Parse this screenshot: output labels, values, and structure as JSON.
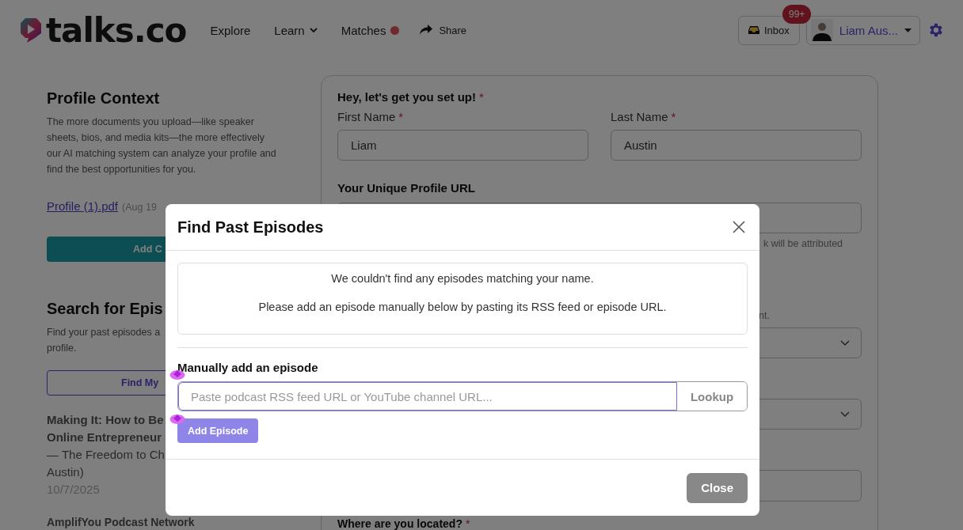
{
  "header": {
    "logo": "talks.co",
    "nav": [
      {
        "label": "Explore",
        "kind": "link"
      },
      {
        "label": "Learn",
        "kind": "dropdown"
      },
      {
        "label": "Matches",
        "kind": "dot"
      },
      {
        "label": "Share",
        "kind": "share"
      }
    ],
    "inbox": {
      "label": "Inbox",
      "badge": "99+"
    },
    "user": {
      "name": "Liam Aus..."
    }
  },
  "profile_context": {
    "title": "Profile Context",
    "description": "The more documents you upload—like speaker sheets, bios, and media kits—the more effectively our AI matching system can analyze your profile and find the best opportunities for you.",
    "file": {
      "name": "Profile (1).pdf",
      "date": "(Aug 19"
    },
    "button": "Add C"
  },
  "search_episodes": {
    "title": "Search for Epis",
    "description_lines": [
      "Find your past episodes a",
      "profile."
    ],
    "button": "Find My"
  },
  "episodes": [
    {
      "title_lines": [
        "Making It: How to Be",
        "Online Entrepreneur"
      ],
      "subtitle_lines": [
        "— The Freedom to Ch",
        "Austin)"
      ],
      "date": "10/7/2025"
    },
    {
      "title_lines": [
        "AmplifYou Podcast Network"
      ]
    }
  ],
  "setup": {
    "title": "Hey, let's get you set up!",
    "required_mark": "*",
    "fields": [
      {
        "label": "First Name",
        "required_mark": "*",
        "value": "Liam"
      },
      {
        "label": "Last Name",
        "required_mark": "*",
        "value": "Austin"
      }
    ],
    "profile_url_label": "Your Unique Profile URL",
    "url_hint": "k will be attributed",
    "second_hint": "nt.",
    "location_label": "Where are you located?",
    "location_required_mark": "*"
  },
  "modal": {
    "title": "Find Past Episodes",
    "messages": [
      "We couldn't find any episodes matching your name.",
      "Please add an episode manually below by pasting its RSS feed or episode URL."
    ],
    "manual_label": "Manually add an episode",
    "input": {
      "placeholder": "Paste podcast RSS feed URL or YouTube channel URL..."
    },
    "lookup_button": "Lookup",
    "add_button": {
      "label": "Add Episode",
      "disabled": true
    },
    "close_button": "Close"
  }
}
